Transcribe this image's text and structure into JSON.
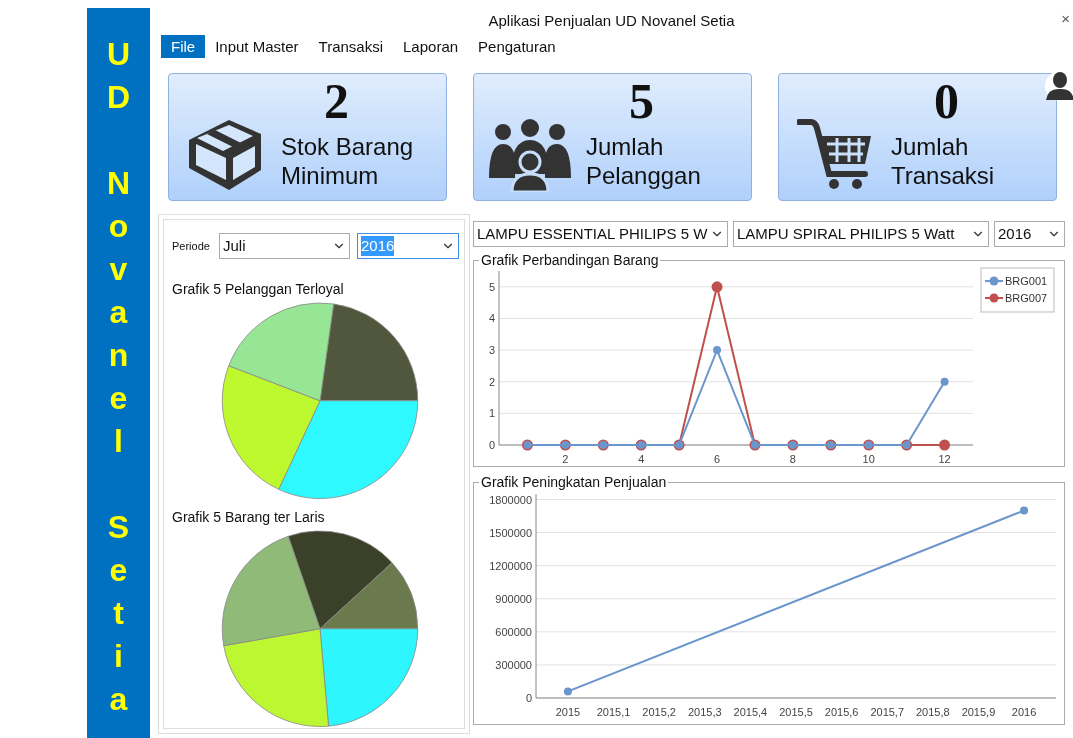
{
  "sidebar": {
    "title": "UD Novanel Setia"
  },
  "window": {
    "title": "Aplikasi Penjualan UD Novanel Setia",
    "close": "×"
  },
  "menu": {
    "items": [
      {
        "label": "File",
        "selected": true
      },
      {
        "label": "Input Master",
        "selected": false
      },
      {
        "label": "Transaksi",
        "selected": false
      },
      {
        "label": "Laporan",
        "selected": false
      },
      {
        "label": "Pengaturan",
        "selected": false
      }
    ]
  },
  "cards": [
    {
      "kind": "box",
      "value": "2",
      "label": "Stok Barang Minimum"
    },
    {
      "kind": "people",
      "value": "5",
      "label": "Jumlah Pelanggan"
    },
    {
      "kind": "cart",
      "value": "0",
      "label": "Jumlah Transaksi"
    }
  ],
  "left_panel": {
    "period_label": "Periode",
    "month": {
      "value": "Juli",
      "focused": false
    },
    "year": {
      "value": "2016",
      "focused": true
    },
    "pie_titles": [
      "Grafik 5 Pelanggan Terloyal",
      "Grafik 5 Barang ter Laris"
    ]
  },
  "right_panel": {
    "selectors": [
      {
        "value": "LAMPU ESSENTIAL PHILIPS 5 W",
        "focused": false
      },
      {
        "value": "LAMPU SPIRAL PHILIPS 5 Watt",
        "focused": false
      },
      {
        "value": "2016",
        "focused": false
      }
    ],
    "comparison": {
      "chart_data": {
        "type": "line",
        "title": "Grafik Perbandingan Barang",
        "x": [
          1,
          2,
          3,
          4,
          5,
          6,
          7,
          8,
          9,
          10,
          11,
          12
        ],
        "legend": "right",
        "grid": true,
        "series": [
          {
            "name": "BRG001",
            "color": "#6b96cc",
            "marker": "circle",
            "values": [
              0,
              0,
              0,
              0,
              0,
              3,
              0,
              0,
              0,
              0,
              0,
              2
            ]
          },
          {
            "name": "BRG007",
            "color": "#c0504d",
            "marker": "circle",
            "values": [
              0,
              0,
              0,
              0,
              0,
              5,
              0,
              0,
              0,
              0,
              0,
              0
            ]
          }
        ],
        "xlim": [
          0.25,
          12.75
        ],
        "ylim": [
          0,
          5.5
        ],
        "xticks": [
          2,
          4,
          6,
          8,
          10,
          12
        ],
        "yticks": [
          0,
          1,
          2,
          3,
          4,
          5
        ]
      }
    },
    "sales": {
      "chart_data": {
        "type": "line",
        "title": "Grafik Peningkatan Penjualan",
        "x": [
          2015,
          2016
        ],
        "values": [
          60000,
          1700000
        ],
        "grid": true,
        "marker": "circle",
        "xlim": [
          2014.93,
          2016.07
        ],
        "ylim": [
          0,
          1850000
        ],
        "xticks": [
          {
            "value": 2015,
            "label": "2015"
          },
          {
            "value": 2015.1,
            "label": "2015,1"
          },
          {
            "value": 2015.2,
            "label": "2015,2"
          },
          {
            "value": 2015.3,
            "label": "2015,3"
          },
          {
            "value": 2015.4,
            "label": "2015,4"
          },
          {
            "value": 2015.5,
            "label": "2015,5"
          },
          {
            "value": 2015.6,
            "label": "2015,6"
          },
          {
            "value": 2015.7,
            "label": "2015,7"
          },
          {
            "value": 2015.8,
            "label": "2015,8"
          },
          {
            "value": 2015.9,
            "label": "2015,9"
          },
          {
            "value": 2016,
            "label": "2016"
          }
        ],
        "yticks": [
          0,
          300000,
          600000,
          900000,
          1200000,
          1500000,
          1800000
        ]
      }
    }
  }
}
